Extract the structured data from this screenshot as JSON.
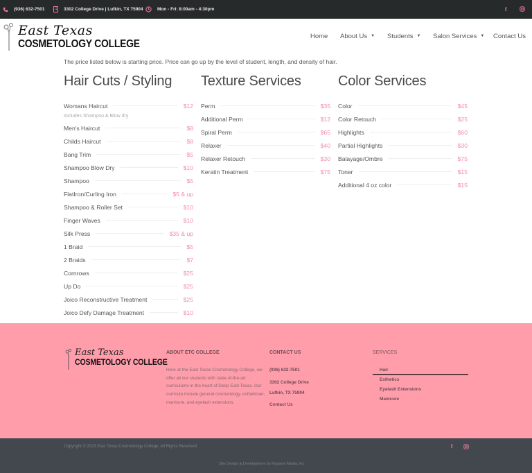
{
  "topbar": {
    "phone": "(936) 632-7501",
    "address": "3302 College Drive | Lufkin, TX 75904",
    "hours": "Mon - Fri: 8:00am - 4:30pm",
    "icons": {
      "phone": "phone-icon",
      "address": "building-icon",
      "hours": "clock-icon",
      "facebook": "facebook-icon",
      "instagram": "instagram-icon"
    },
    "accent_color": "#e87a9a"
  },
  "header": {
    "logo": {
      "script": "East Texas",
      "block": "COSMETOLOGY COLLEGE"
    },
    "nav": [
      {
        "label": "Home",
        "has_dropdown": false
      },
      {
        "label": "About Us",
        "has_dropdown": true
      },
      {
        "label": "Students",
        "has_dropdown": true
      },
      {
        "label": "Salon Services",
        "has_dropdown": true
      },
      {
        "label": "Contact Us",
        "has_dropdown": false
      }
    ]
  },
  "main": {
    "intro": "The price listed below is starting price.  Price can go up by the level of student, length, and density of hair.",
    "price_color": "#f48ba8",
    "columns": [
      {
        "title": "Hair Cuts / Styling",
        "items": [
          {
            "name": "Womans Haircut",
            "price": "$12",
            "note": "Includes Shampoo & Blow dry"
          },
          {
            "name": "Men's Haircut",
            "price": "$8"
          },
          {
            "name": "Childs Haircut",
            "price": "$8"
          },
          {
            "name": "Bang Trim",
            "price": "$5"
          },
          {
            "name": "Shampoo Blow Dry",
            "price": "$10"
          },
          {
            "name": "Shampoo",
            "price": "$5"
          },
          {
            "name": "FlatIron/Curling Iron",
            "price": "$5 & up"
          },
          {
            "name": "Shampoo & Roller Set",
            "price": "$10"
          },
          {
            "name": "Finger Waves",
            "price": "$10"
          },
          {
            "name": "Silk Press",
            "price": "$35 & up"
          },
          {
            "name": "1 Braid",
            "price": "$5"
          },
          {
            "name": "2 Braids",
            "price": "$7"
          },
          {
            "name": "Cornrows",
            "price": "$25"
          },
          {
            "name": "Up Do",
            "price": "$25"
          },
          {
            "name": "Joico Reconstructive Treatment",
            "price": "$25"
          },
          {
            "name": "Joico Defy Damage Treatment",
            "price": "$10"
          }
        ]
      },
      {
        "title": "Texture Services",
        "items": [
          {
            "name": "Perm",
            "price": "$35"
          },
          {
            "name": "Additional Perm",
            "price": "$12"
          },
          {
            "name": "Spiral Perm",
            "price": "$65"
          },
          {
            "name": "Relaxer",
            "price": "$40"
          },
          {
            "name": "Relaxer Retouch",
            "price": "$30"
          },
          {
            "name": "Keratin Treatment",
            "price": "$75"
          }
        ]
      },
      {
        "title": "Color Services",
        "items": [
          {
            "name": "Color",
            "price": "$45"
          },
          {
            "name": "Color Retouch",
            "price": "$25"
          },
          {
            "name": "Highlights",
            "price": "$60"
          },
          {
            "name": "Partial Highlights",
            "price": "$30"
          },
          {
            "name": "Balayage/Ombre",
            "price": "$75"
          },
          {
            "name": "Toner",
            "price": "$15"
          },
          {
            "name": "Additional 4 oz color",
            "price": "$15"
          }
        ]
      }
    ]
  },
  "footer": {
    "background": "#ff9dab",
    "logo": {
      "script": "East Texas",
      "block": "COSMETOLOGY COLLEGE"
    },
    "about": {
      "heading": "ABOUT ETC COLLEGE",
      "text": "Here at the East Texas Cosmetology College, we offer all our students with state-of-the-art curriculums in the heart of Deep East Texas. Our curricula include general cosmetology, esthetician, manicure, and eyelash extensions."
    },
    "contact": {
      "heading": "CONTACT US",
      "phone": "(936) 632-7501",
      "street": "3302 College Drive",
      "city": "Lufkin, TX 75904",
      "link": "Contact Us"
    },
    "services": {
      "heading": "SERVICES",
      "items": [
        "Hair",
        "Esthetics",
        "Eyelash Extensions",
        "Manicure"
      ]
    }
  },
  "bottom": {
    "copyright": "Copyright © 2023 East Texas Cosmetology College, All Rights Reserved",
    "credit": "Site Design & Development by Mussevi Media, Inc"
  }
}
